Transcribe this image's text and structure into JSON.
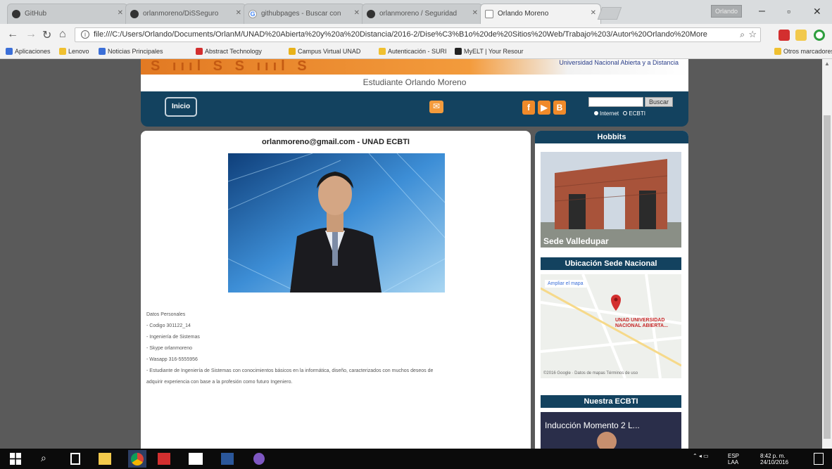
{
  "browser": {
    "tabs": [
      {
        "label": "GitHub"
      },
      {
        "label": "orlanmoreno/DiSSeguro"
      },
      {
        "label": "githubpages - Buscar con"
      },
      {
        "label": "orlanmoreno / Seguridad"
      },
      {
        "label": "Orlando Moreno"
      }
    ],
    "user_button": "Orlando",
    "url": "file:///C:/Users/Orlando/Documents/OrlanM/UNAD%20Abierta%20y%20a%20Distancia/2016-2/Dise%C3%B1o%20de%20Sitios%20Web/Trabajo%203/Autor%20Orlando%20More",
    "bookmarks": [
      {
        "label": "Aplicaciones"
      },
      {
        "label": "Lenovo"
      },
      {
        "label": "Noticias Principales"
      },
      {
        "label": "Abstract Technology"
      },
      {
        "label": "Campus Virtual UNAD"
      },
      {
        "label": "Autenticación - SURI"
      },
      {
        "label": "MyELT | Your Resour"
      }
    ],
    "other_bookmarks": "Otros marcadores"
  },
  "site": {
    "university": "Universidad Nacional Abierta y a Distancia",
    "subtitle": "Estudiante Orlando Moreno",
    "nav": {
      "home": "Inicio",
      "search_button": "Buscar",
      "radio_internet": "Internet",
      "radio_ecbti": "ECBTI"
    },
    "main": {
      "header": "orlanmoreno@gmail.com - UNAD ECBTI",
      "details": [
        "Datos Personales",
        "- Codigo 301122_14",
        "- Ingeniería de Sistemas",
        "- Skype orlanmoreno",
        "- Wasapp 316-5555956",
        "- Estudiante de Ingeniería de Sistemas con conocimientos básicos en la informática, diseño, caracterizados con muchos deseos de",
        "adquirir experiencia con base a la profesión como futuro Ingeniero."
      ]
    },
    "sidebar": {
      "hobbits_title": "Hobbits",
      "sede_caption": "Sede Valledupar",
      "map_title": "Ubicación Sede Nacional",
      "map_expand": "Ampliar el mapa",
      "map_label": "UNAD UNIVERSIDAD NACIONAL ABIERTA...",
      "map_footer": "©2016 Google · Datos de mapas   Términos de uso",
      "ecbti_title": "Nuestra ECBTI",
      "video_title": "Inducción Momento 2 L..."
    }
  },
  "taskbar": {
    "lang": "ESP",
    "region": "LAA",
    "time": "8:42 p. m.",
    "date": "24/10/2016"
  },
  "colors": {
    "site_navy": "#13425f",
    "site_orange": "#f39b3c",
    "page_background": "#5a5a5a"
  }
}
